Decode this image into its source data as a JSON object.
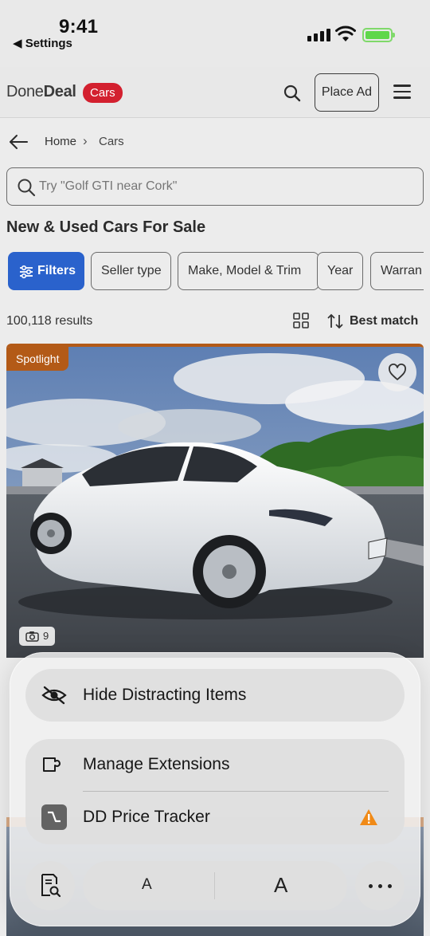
{
  "status_bar": {
    "time": "9:41",
    "back_label": "◀ Settings",
    "icons": [
      "cellular-signal-icon",
      "wifi-icon",
      "battery-charging-icon"
    ]
  },
  "header": {
    "logo_done": "Done",
    "logo_deal": "Deal",
    "logo_badge": "Cars",
    "place_ad_label": "Place Ad",
    "brand_color": "#d3202f"
  },
  "breadcrumb": {
    "items": [
      "Home",
      "Cars"
    ],
    "separator": "›"
  },
  "search": {
    "placeholder": "Try \"Golf GTI near Cork\""
  },
  "page": {
    "title": "New & Used Cars For Sale"
  },
  "filters": {
    "chips": [
      "Filters",
      "Seller type",
      "Make, Model & Trim",
      "Year",
      "Warran"
    ],
    "active_color": "#2a62cc"
  },
  "results": {
    "count_text": "100,118 results",
    "sort_label": "Best match"
  },
  "listing": {
    "badge": "Spotlight",
    "photo_count": "9",
    "accent_color": "#b35a17"
  },
  "sheet": {
    "hide_label": "Hide Distracting Items",
    "manage_label": "Manage Extensions",
    "extension_label": "DD Price Tracker",
    "font_small": "A",
    "font_large": "A"
  }
}
